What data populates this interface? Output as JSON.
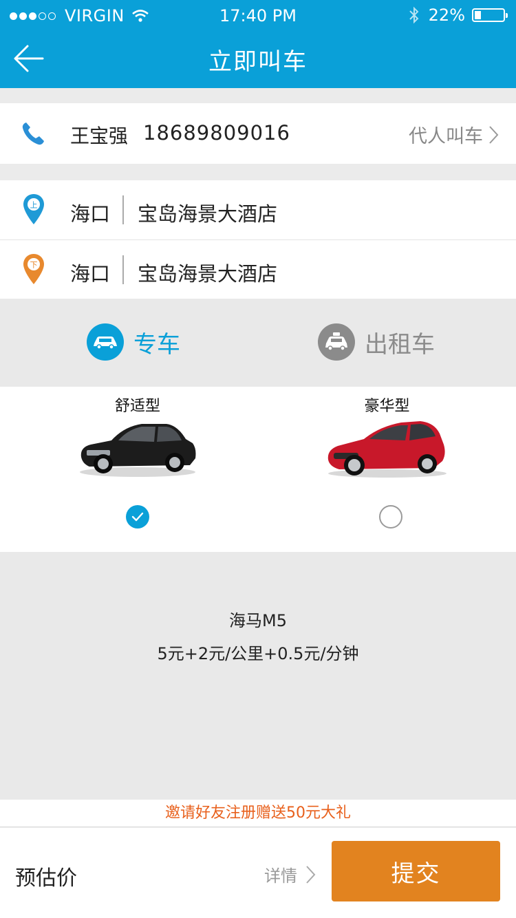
{
  "status_bar": {
    "carrier": "VIRGIN",
    "time": "17:40 PM",
    "battery": "22%",
    "signal_bars": 3,
    "signal_total": 5
  },
  "header": {
    "title": "立即叫车",
    "back_icon": "back-arrow-icon",
    "background_color": "#0aa0d8"
  },
  "contact": {
    "name": "王宝强",
    "phone": "18689809016",
    "proxy_label": "代人叫车",
    "icon": "phone-icon"
  },
  "pickup": {
    "badge": "上",
    "city": "海口",
    "place": "宝岛海景大酒店",
    "color": "#1f9ad6"
  },
  "dropoff": {
    "badge": "下",
    "city": "海口",
    "place": "宝岛海景大酒店",
    "color": "#e8892e"
  },
  "car_types": {
    "options": [
      {
        "label": "专车",
        "icon": "car-icon",
        "selected": true
      },
      {
        "label": "出租车",
        "icon": "taxi-icon",
        "selected": false
      }
    ]
  },
  "car_classes": [
    {
      "label": "舒适型",
      "image": "black-sedan",
      "selected": true
    },
    {
      "label": "豪华型",
      "image": "red-coupe",
      "selected": false
    }
  ],
  "car_info": {
    "model": "海马M5",
    "price": "5元+2元/公里+0.5元/分钟"
  },
  "promo": {
    "text": "邀请好友注册赠送50元大礼",
    "color": "#e8601c"
  },
  "footer": {
    "estimate_label": "预估价",
    "details_label": "详情",
    "submit_label": "提交",
    "submit_color": "#e2831f"
  }
}
